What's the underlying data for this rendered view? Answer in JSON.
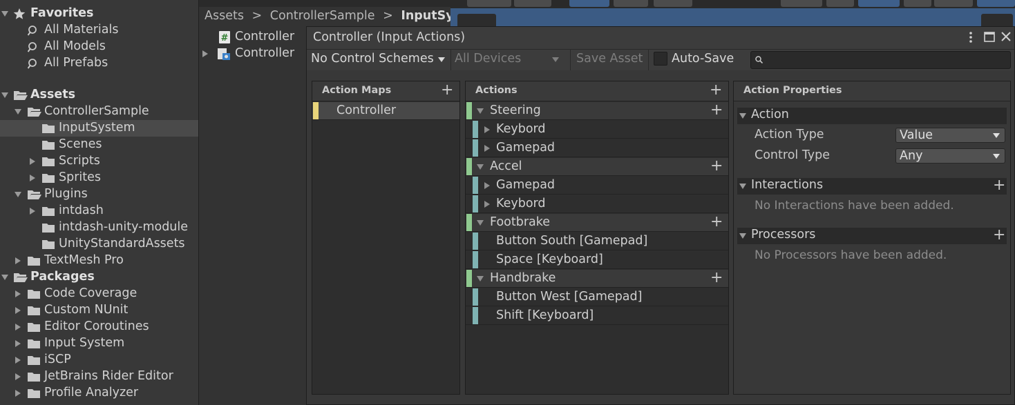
{
  "project": {
    "favorites_label": "Favorites",
    "favorites": [
      "All Materials",
      "All Models",
      "All Prefabs"
    ],
    "assets_label": "Assets",
    "tree": [
      {
        "label": "ControllerSample",
        "indent": 1
      },
      {
        "label": "InputSystem",
        "indent": 2,
        "selected": true
      },
      {
        "label": "Scenes",
        "indent": 2
      },
      {
        "label": "Scripts",
        "indent": 2
      },
      {
        "label": "Sprites",
        "indent": 2
      },
      {
        "label": "Plugins",
        "indent": 1
      },
      {
        "label": "intdash",
        "indent": 2
      },
      {
        "label": "intdash-unity-module",
        "indent": 2
      },
      {
        "label": "UnityStandardAssets",
        "indent": 2
      },
      {
        "label": "TextMesh Pro",
        "indent": 1
      }
    ],
    "packages_label": "Packages",
    "packages": [
      "Code Coverage",
      "Custom NUnit",
      "Editor Coroutines",
      "Input System",
      "iSCP",
      "JetBrains Rider Editor",
      "Profile Analyzer"
    ]
  },
  "breadcrumb": {
    "part1": "Assets",
    "part2": "ControllerSample",
    "part3": "InputSyste",
    "sep": ">"
  },
  "asset_list": [
    {
      "label": "Controller",
      "icon": "script-icon"
    },
    {
      "label": "Controller",
      "icon": "input-actions-icon"
    }
  ],
  "window": {
    "title": "Controller (Input Actions)",
    "toolbar": {
      "control_schemes": "No Control Schemes",
      "devices": "All Devices",
      "save_asset": "Save Asset",
      "auto_save": "Auto-Save",
      "search_placeholder": ""
    },
    "action_maps": {
      "header": "Action Maps",
      "items": [
        "Controller"
      ]
    },
    "actions": {
      "header": "Actions",
      "items": [
        {
          "name": "Steering",
          "bindings": [
            "Keybord",
            "Gamepad"
          ]
        },
        {
          "name": "Accel",
          "bindings": [
            "Gamepad",
            "Keybord"
          ]
        },
        {
          "name": "Footbrake",
          "bindings": [
            "Button South [Gamepad]",
            "Space [Keyboard]"
          ]
        },
        {
          "name": "Handbrake",
          "bindings": [
            "Button West [Gamepad]",
            "Shift [Keyboard]"
          ]
        }
      ]
    },
    "properties": {
      "header": "Action Properties",
      "action_section": "Action",
      "action_type_label": "Action Type",
      "action_type_value": "Value",
      "control_type_label": "Control Type",
      "control_type_value": "Any",
      "interactions_section": "Interactions",
      "interactions_empty": "No Interactions have been added.",
      "processors_section": "Processors",
      "processors_empty": "No Processors have been added."
    }
  },
  "colors": {
    "map_stripe": "#e8d47a",
    "action_stripe": "#8fc98f",
    "binding_stripe": "#7fb3b3",
    "scene_blue": "#3e5f8a"
  }
}
